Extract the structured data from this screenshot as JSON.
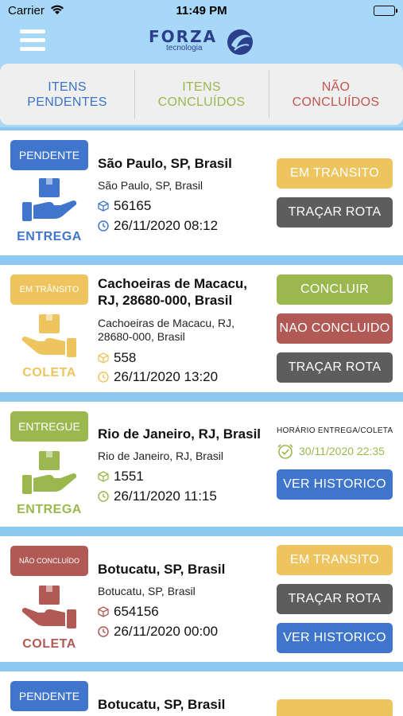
{
  "status_bar": {
    "carrier": "Carrier",
    "time": "11:49 PM"
  },
  "header": {
    "logo_text": "FORZA",
    "logo_sub": "tecnologia"
  },
  "tabs": [
    {
      "label": "ITENS PENDENTES"
    },
    {
      "label": "ITENS CONCLUÍDOS"
    },
    {
      "label": "NÃO CONCLUÍDOS"
    }
  ],
  "colors": {
    "blue": "#3f76cc",
    "yellow": "#edc45e",
    "green": "#9bb84f",
    "red": "#b15a55",
    "gray": "#5d5d5d",
    "background": "#8cc8f0"
  },
  "cards": [
    {
      "status": "PENDENTE",
      "type": "ENTREGA",
      "address_title": "São Paulo, SP, Brasil",
      "address_sub": "São Paulo, SP, Brasil",
      "package_id": "56165",
      "datetime": "26/11/2020 08:12",
      "buttons": [
        "EM TRANSITO",
        "TRAÇAR ROTA"
      ]
    },
    {
      "status": "EM TRÂNSITO",
      "type": "COLETA",
      "address_title": "Cachoeiras de Macacu, RJ, 28680-000, Brasil",
      "address_sub": "Cachoeiras de Macacu, RJ, 28680-000, Brasil",
      "package_id": "558",
      "datetime": "26/11/2020 13:20",
      "buttons": [
        "CONCLUIR",
        "NAO CONCLUIDO",
        "TRAÇAR ROTA"
      ]
    },
    {
      "status": "ENTREGUE",
      "type": "ENTREGA",
      "address_title": "Rio de Janeiro, RJ, Brasil",
      "address_sub": "Rio de Janeiro, RJ, Brasil",
      "package_id": "1551",
      "datetime": "26/11/2020 11:15",
      "schedule_label": "HORÁRIO ENTREGA/COLETA",
      "schedule_value": "30/11/2020 22:35",
      "buttons": [
        "VER HISTORICO"
      ]
    },
    {
      "status": "NÃO CONCLUÍDO",
      "type": "COLETA",
      "address_title": "Botucatu, SP, Brasil",
      "address_sub": "Botucatu, SP, Brasil",
      "package_id": "654156",
      "datetime": "26/11/2020 00:00",
      "buttons": [
        "EM TRANSITO",
        "TRAÇAR ROTA",
        "VER HISTORICO"
      ]
    },
    {
      "status": "PENDENTE",
      "address_title": "Botucatu, SP, Brasil"
    }
  ]
}
